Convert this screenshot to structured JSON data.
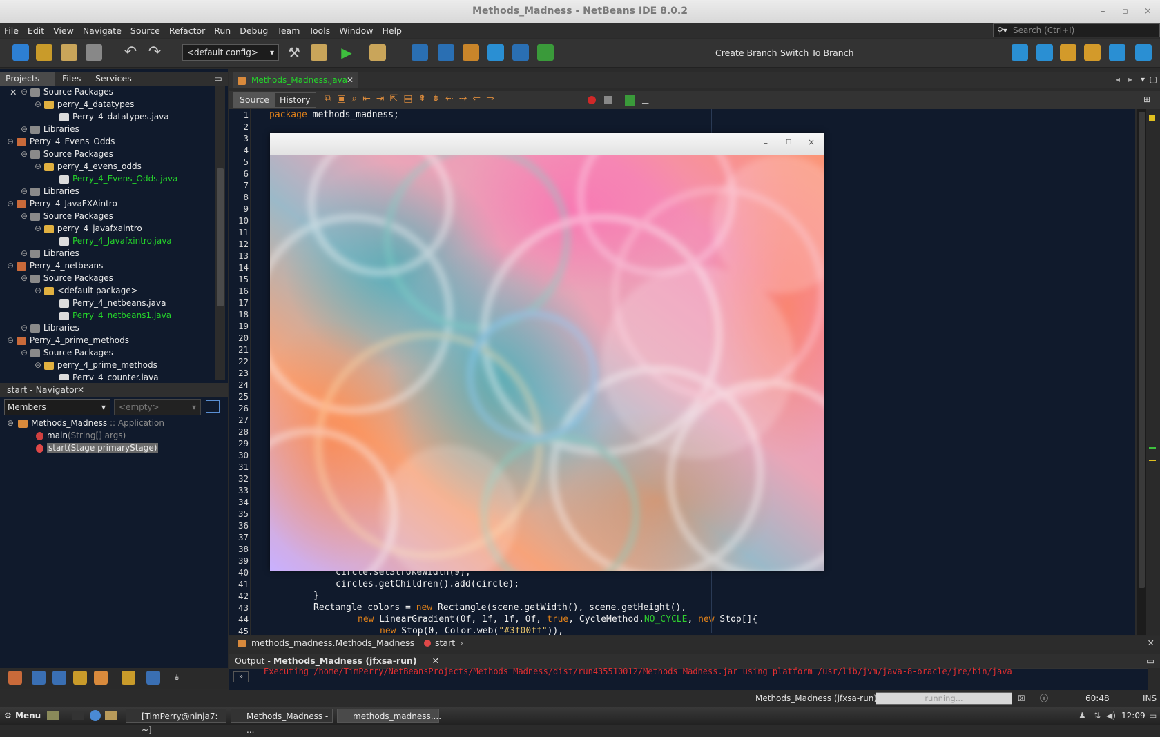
{
  "window": {
    "title": "Methods_Madness - NetBeans IDE 8.0.2",
    "controls": [
      "minimize",
      "maximize",
      "close"
    ]
  },
  "menu": [
    "File",
    "Edit",
    "View",
    "Navigate",
    "Source",
    "Refactor",
    "Run",
    "Debug",
    "Team",
    "Tools",
    "Window",
    "Help"
  ],
  "search": {
    "placeholder": "Search (Ctrl+I)"
  },
  "toolbar": {
    "config": "<default config>",
    "create_branch": "Create Branch",
    "switch_branch": "Switch To Branch"
  },
  "panel_tabs": {
    "projects": "Projects",
    "files": "Files",
    "services": "Services"
  },
  "tree": [
    {
      "label": "Source Packages",
      "indent": 2,
      "kind": "srcpkg"
    },
    {
      "label": "perry_4_datatypes",
      "indent": 3,
      "kind": "pkg"
    },
    {
      "label": "Perry_4_datatypes.java",
      "indent": 4,
      "kind": "java"
    },
    {
      "label": "Libraries",
      "indent": 2,
      "kind": "lib"
    },
    {
      "label": "Perry_4_Evens_Odds",
      "indent": 1,
      "kind": "project"
    },
    {
      "label": "Source Packages",
      "indent": 2,
      "kind": "srcpkg"
    },
    {
      "label": "perry_4_evens_odds",
      "indent": 3,
      "kind": "pkg"
    },
    {
      "label": "Perry_4_Evens_Odds.java",
      "indent": 4,
      "kind": "java",
      "modified": true
    },
    {
      "label": "Libraries",
      "indent": 2,
      "kind": "lib"
    },
    {
      "label": "Perry_4_JavaFXAintro",
      "indent": 1,
      "kind": "project"
    },
    {
      "label": "Source Packages",
      "indent": 2,
      "kind": "srcpkg"
    },
    {
      "label": "perry_4_javafxaintro",
      "indent": 3,
      "kind": "pkg"
    },
    {
      "label": "Perry_4_Javafxintro.java",
      "indent": 4,
      "kind": "java",
      "modified": true
    },
    {
      "label": "Libraries",
      "indent": 2,
      "kind": "lib"
    },
    {
      "label": "Perry_4_netbeans",
      "indent": 1,
      "kind": "project"
    },
    {
      "label": "Source Packages",
      "indent": 2,
      "kind": "srcpkg"
    },
    {
      "label": "<default package>",
      "indent": 3,
      "kind": "pkg"
    },
    {
      "label": "Perry_4_netbeans.java",
      "indent": 4,
      "kind": "java"
    },
    {
      "label": "Perry_4_netbeans1.java",
      "indent": 4,
      "kind": "java",
      "modified": true
    },
    {
      "label": "Libraries",
      "indent": 2,
      "kind": "lib"
    },
    {
      "label": "Perry_4_prime_methods",
      "indent": 1,
      "kind": "project"
    },
    {
      "label": "Source Packages",
      "indent": 2,
      "kind": "srcpkg"
    },
    {
      "label": "perry_4_prime_methods",
      "indent": 3,
      "kind": "pkg"
    },
    {
      "label": "Perry_4_counter.java",
      "indent": 4,
      "kind": "java"
    }
  ],
  "navigator": {
    "title": "start - Navigator",
    "members": "Members",
    "empty": "<empty>",
    "class_name": "Methods_Madness",
    "class_suffix": ":: Application",
    "items": [
      {
        "name": "main",
        "params": "(String[] args)"
      },
      {
        "name": "start(Stage primaryStage)",
        "selected": true
      }
    ]
  },
  "editor": {
    "tab": "Methods_Madness.java",
    "source_btn": "Source",
    "history_btn": "History",
    "line_numbers": [
      "1",
      "2",
      "3",
      "4",
      "5",
      "6",
      "7",
      "8",
      "9",
      "10",
      "11",
      "12",
      "13",
      "14",
      "15",
      "16",
      "17",
      "18",
      "19",
      "20",
      "21",
      "22",
      "23",
      "24",
      "25",
      "26",
      "27",
      "28",
      "29",
      "30",
      "31",
      "32",
      "33",
      "34",
      "35",
      "36",
      "37",
      "38",
      "39",
      "40",
      "41",
      "42",
      "43",
      "44",
      "45"
    ],
    "code": {
      "l1_kw": "package",
      "l1_rest": " methods_madness;",
      "l40": "circle.setStrokeWidth(9);",
      "l41": "circles.getChildren().add(circle);",
      "l42": "}",
      "l43_a": "Rectangle colors = ",
      "l43_kw": "new",
      "l43_b": " Rectangle(scene.getWidth(), scene.getHeight(),",
      "l44_kw": "new",
      "l44_a": " LinearGradient(0f, 1f, 1f, 0f, ",
      "l44_kw2": "true",
      "l44_b": ", CycleMethod.",
      "l44_fld": "NO_CYCLE",
      "l44_c": ", ",
      "l44_kw3": "new",
      "l44_d": " Stop[]{",
      "l45_kw": "new",
      "l45_a": " Stop(0, Color.web(",
      "l45_str": "\"#3f00ff\"",
      "l45_b": ")),"
    },
    "breadcrumb": [
      "methods_madness.Methods_Madness",
      "start"
    ]
  },
  "output": {
    "tab_prefix": "Output - ",
    "tab_name": "Methods_Madness (jfxsa-run)",
    "line": "Executing /home/TimPerry/NetBeansProjects/Methods_Madness/dist/run435510012/Methods_Madness.jar using platform /usr/lib/jvm/java-8-oracle/jre/bin/java"
  },
  "status": {
    "task": "Methods_Madness (jfxsa-run)",
    "progress": "running...",
    "position": "60:48",
    "mode": "INS"
  },
  "taskbar": {
    "menu": "Menu",
    "tasks": [
      "[TimPerry@ninja7: ~]",
      "Methods_Madness - ...",
      "methods_madness...."
    ],
    "time": "12:09"
  },
  "colors": {
    "accent_green": "#25d32b",
    "editor_bg": "#101a2c",
    "error_red": "#e03030"
  }
}
